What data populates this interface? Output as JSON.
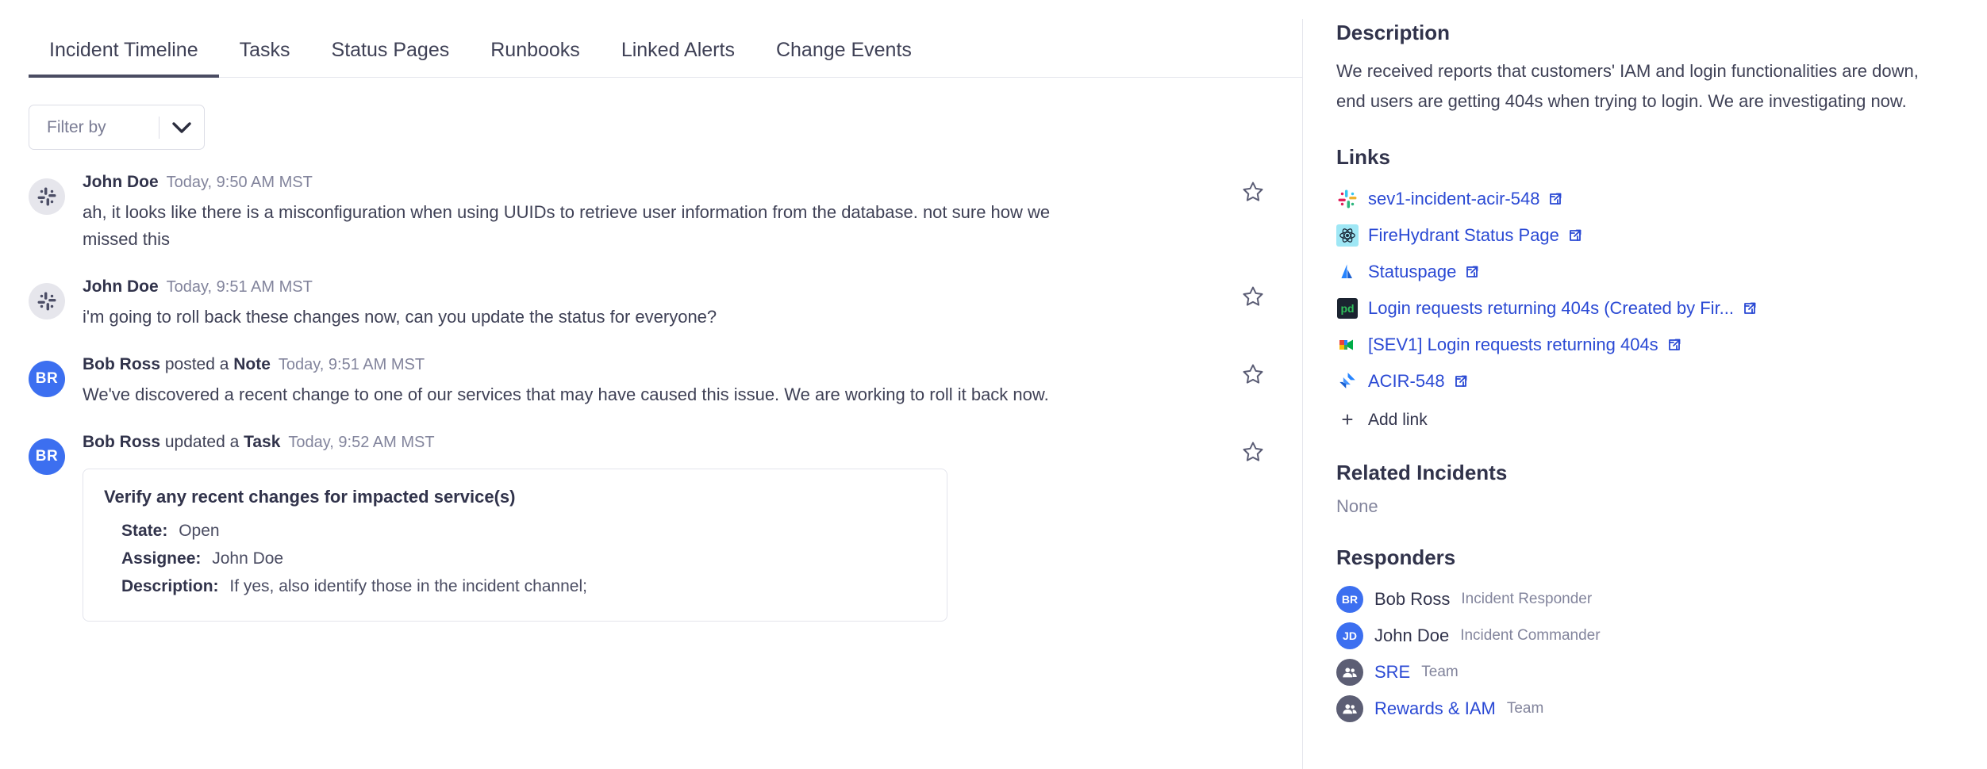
{
  "tabs": [
    {
      "label": "Incident Timeline",
      "active": true
    },
    {
      "label": "Tasks",
      "active": false
    },
    {
      "label": "Status Pages",
      "active": false
    },
    {
      "label": "Runbooks",
      "active": false
    },
    {
      "label": "Linked Alerts",
      "active": false
    },
    {
      "label": "Change Events",
      "active": false
    }
  ],
  "filter": {
    "label": "Filter by",
    "chevron_icon": "chevron-down-icon"
  },
  "timeline": [
    {
      "avatar_type": "slack",
      "avatar_icon": "slack-icon",
      "author": "John Doe",
      "action": "",
      "action_bold": "",
      "time": "Today, 9:50 AM MST",
      "text": "ah, it looks like there is a misconfiguration when using UUIDs to retrieve user information from the database. not sure how we missed this",
      "star_icon": "star-outline-icon"
    },
    {
      "avatar_type": "slack",
      "avatar_icon": "slack-icon",
      "author": "John Doe",
      "action": "",
      "action_bold": "",
      "time": "Today, 9:51 AM MST",
      "text": "i'm going to roll back these changes now, can you update the status for everyone?",
      "star_icon": "star-outline-icon"
    },
    {
      "avatar_type": "initials",
      "avatar_initials": "BR",
      "author": "Bob Ross",
      "action": " posted a ",
      "action_bold": "Note",
      "time": "Today, 9:51 AM MST",
      "text": "We've discovered a recent change to one of our services that may have caused this issue. We are working to roll it back now.",
      "star_icon": "star-outline-icon"
    },
    {
      "avatar_type": "initials",
      "avatar_initials": "BR",
      "author": "Bob Ross",
      "action": " updated a ",
      "action_bold": "Task",
      "time": "Today, 9:52 AM MST",
      "text": "",
      "star_icon": "star-outline-icon",
      "task_card": {
        "title": "Verify any recent changes for impacted service(s)",
        "fields": [
          {
            "key": "State:",
            "value": "Open"
          },
          {
            "key": "Assignee:",
            "value": "John Doe"
          },
          {
            "key": "Description:",
            "value": "If yes, also identify those in the incident channel;"
          }
        ]
      }
    }
  ],
  "sidebar": {
    "description_heading": "Description",
    "description_text": "We received reports that customers' IAM and login functionalities are down, end users are getting 404s when trying to login. We are investigating now.",
    "links_heading": "Links",
    "links": [
      {
        "label": "sev1-incident-acir-548",
        "icon": "slack-color-icon",
        "external_icon": "external-link-icon"
      },
      {
        "label": "FireHydrant Status Page",
        "icon": "firehydrant-icon",
        "external_icon": "external-link-icon"
      },
      {
        "label": "Statuspage",
        "icon": "atlassian-statuspage-icon",
        "external_icon": "external-link-icon"
      },
      {
        "label": "Login requests returning 404s (Created by Fir...",
        "icon": "pagerduty-icon",
        "external_icon": "external-link-icon"
      },
      {
        "label": "[SEV1] Login requests returning 404s",
        "icon": "google-meet-icon",
        "external_icon": "external-link-icon"
      },
      {
        "label": "ACIR-548",
        "icon": "jira-icon",
        "external_icon": "external-link-icon"
      }
    ],
    "add_link_label": "Add link",
    "add_link_icon": "plus-icon",
    "related_incidents_heading": "Related Incidents",
    "related_incidents_value": "None",
    "responders_heading": "Responders",
    "responders": [
      {
        "initials": "BR",
        "name": "Bob Ross",
        "role": "Incident Responder",
        "type": "person",
        "avatar_icon": "user-initials-avatar"
      },
      {
        "initials": "JD",
        "name": "John Doe",
        "role": "Incident Commander",
        "type": "person",
        "avatar_icon": "user-initials-avatar"
      },
      {
        "initials": "",
        "name": "SRE",
        "role": "Team",
        "type": "team",
        "avatar_icon": "team-people-icon"
      },
      {
        "initials": "",
        "name": "Rewards & IAM",
        "role": "Team",
        "type": "team",
        "avatar_icon": "team-people-icon"
      }
    ]
  },
  "colors": {
    "link_blue": "#2a49d4",
    "avatar_blue": "#3c6ff0",
    "text_primary": "#31334b",
    "text_muted": "#82849c",
    "border": "#e4e5ec",
    "tab_active_underline": "#4a4c62"
  }
}
